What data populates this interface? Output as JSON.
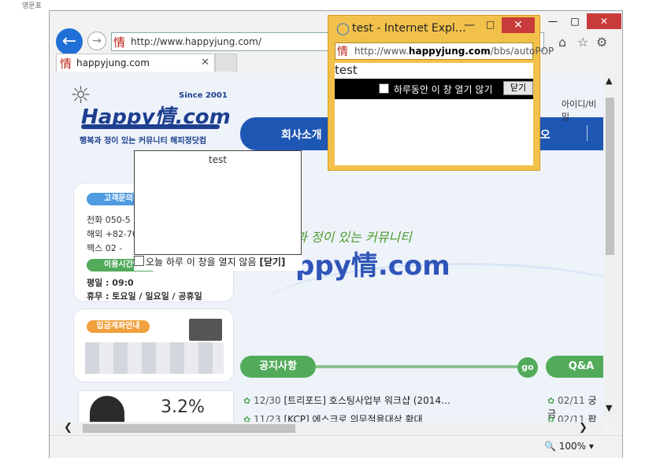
{
  "caption": "영문표",
  "browser": {
    "address_url": "http://www.happyjung.com/",
    "tab_title": "happyjung.com",
    "favicon": "情",
    "zoom": "100%"
  },
  "site": {
    "since": "Since 2001",
    "logo": "Happy情.com",
    "tagline": "행복과 정이 있는 커뮤니티 해피정닷컴",
    "menu": [
      "회사소개",
      "리오"
    ],
    "login_link": "아이디/비밀",
    "hero_sub": "과 정이 있는 커뮤니티",
    "hero_main": "ppy情.com",
    "cs": {
      "label": "고객문의전",
      "rows": [
        "전화 050-5",
        "해외 +82-70",
        "팩스 02 -"
      ],
      "hours_label": "이용시간안",
      "hours_rows": [
        "평일 : 09:0",
        "휴무 : 토요일 / 일요일 / 공휴일"
      ]
    },
    "bank_label": "입금계좌안내",
    "ad_rate": "3.2%",
    "notice": {
      "label": "공지사항",
      "go": "go",
      "items": [
        {
          "date": "12/30",
          "title": "[트리포드] 호스팅사업부 워크샵 (2014…"
        },
        {
          "date": "11/23",
          "title": "[KCP] 에스크로 의무적용대상 확대"
        }
      ]
    },
    "qa": {
      "label": "Q&A",
      "items": [
        {
          "date": "02/11",
          "title": "궁금"
        },
        {
          "date": "02/11",
          "title": "팝"
        }
      ]
    }
  },
  "inpage_popup": {
    "title": "test",
    "checkbox_label": "오늘 하루 이 창을 열지 않음",
    "close_label": "[닫기]"
  },
  "popup_window": {
    "title": "test - Internet Expl…",
    "url_prefix": "http://www.",
    "url_domain": "happyjung.com",
    "url_suffix": "/bbs/autoPOP",
    "body_text": "test",
    "checkbox_label": "하루동안 이 창 열기 않기",
    "close_button": "닫기"
  }
}
